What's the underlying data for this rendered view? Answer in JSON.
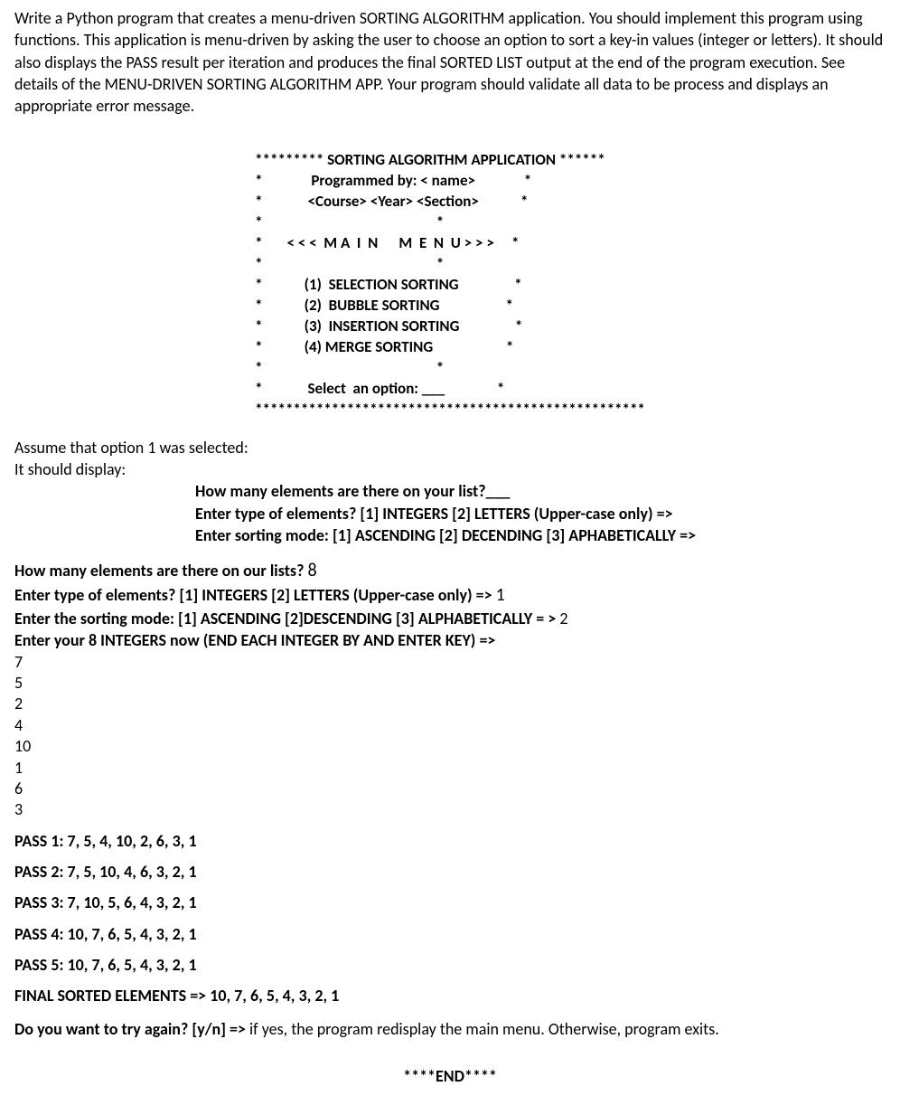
{
  "intro": "Write a Python program that creates a menu-driven SORTING ALGORITHM application. You should implement this program using functions. This application is menu-driven by asking the user to choose an option to sort a key-in values (integer or letters).  It should also displays the PASS result per iteration and produces the final SORTED LIST output at the end of the program execution. See details of the MENU-DRIVEN SORTING ALGORITHM APP. Your program should validate all data to be process and displays an appropriate error message.",
  "menu": {
    "topStars": "********* SORTING ALGORITHM APPLICATION ******",
    "line2": "*              Programmed by: < name>              *",
    "line3": "*             <Course> <Year> <Section>            *",
    "line4": "*                                                  *",
    "line5": "*       < < <  M A  I  N      M  E  N  U > > >     *",
    "line6": "*                                                  *",
    "opt1": "*            (1)  SELECTION SORTING                *",
    "opt2": "*            (2)  BUBBLE SORTING                   *",
    "opt3": "*            (3)  INSERTION SORTING                *",
    "opt4": "*            (4) MERGE SORTING                     *",
    "line11": "*                                                  *",
    "select": "*             Select  an option: ___               *",
    "bottom": "***************************************************"
  },
  "assume1": "Assume that option 1 was selected:",
  "assume2": "It should display:",
  "prompt1": "How many elements are there on your list?___",
  "prompt2": "Enter type of elements? [1] INTEGERS  [2] LETTERS (Upper-case only) =>",
  "prompt3": "Enter sorting mode: [1] ASCENDING [2] DECENDING [3] APHABETICALLY =>",
  "run": {
    "q1": "How many elements are there on our lists?",
    "a1": "8",
    "q2": "Enter type of elements? [1] INTEGERS [2] LETTERS (Upper-case only) =>",
    "a2": "1",
    "q3": "Enter the sorting mode: [1] ASCENDING [2]DESCENDING [3] ALPHABETICALLY = >",
    "a3": "2",
    "q4": "Enter your 8 INTEGERS now (END EACH INTEGER BY AND ENTER KEY) =>",
    "nums": [
      "7",
      "5",
      "2",
      "4",
      "10",
      "1",
      "6",
      "3"
    ]
  },
  "passes": {
    "p1": "PASS 1:  7, 5, 4, 10, 2, 6, 3, 1",
    "p2": "PASS 2:  7, 5, 10, 4, 6, 3, 2, 1",
    "p3": "PASS 3:  7, 10, 5, 6, 4, 3, 2, 1",
    "p4": "PASS 4: 10, 7, 6, 5, 4, 3, 2, 1",
    "p5": "PASS 5: 10, 7, 6, 5, 4, 3, 2, 1",
    "final": "FINAL SORTED ELEMENTS => 10, 7, 6, 5, 4, 3, 2, 1"
  },
  "again": "Do you want to try again? [y/n]   => ",
  "again_tail": "if yes, the program redisplay the main menu. Otherwise, program exits.",
  "end": "****END****"
}
